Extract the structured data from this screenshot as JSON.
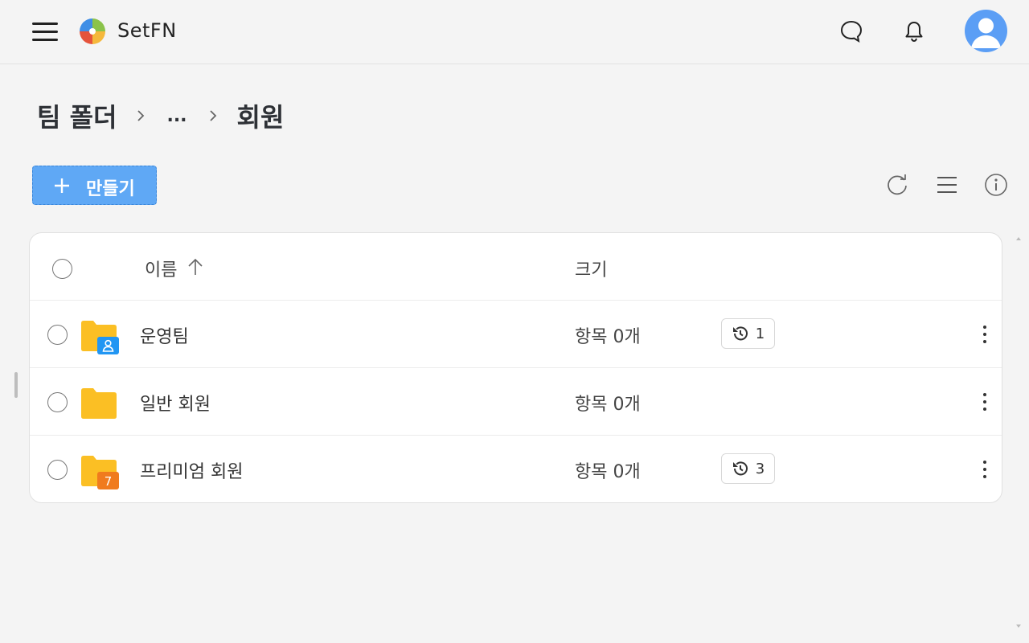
{
  "header": {
    "brand": "SetFN",
    "icons": [
      "menu-icon",
      "chat-icon",
      "bell-icon",
      "avatar-icon"
    ]
  },
  "breadcrumb": {
    "root": "팀 폴더",
    "ellipsis": "...",
    "current": "회원"
  },
  "toolbar": {
    "create_label": "만들기",
    "icons": [
      "refresh-icon",
      "list-view-icon",
      "info-icon"
    ]
  },
  "table": {
    "columns": {
      "name": "이름",
      "size": "크기"
    },
    "sort": "ascending",
    "rows": [
      {
        "name": "운영팀",
        "size": "항목 0개",
        "versions": "1",
        "folder_badge": "user",
        "badge_color": "#2196f3"
      },
      {
        "name": "일반 회원",
        "size": "항목 0개",
        "versions": "",
        "folder_badge": "",
        "badge_color": ""
      },
      {
        "name": "프리미엄 회원",
        "size": "항목 0개",
        "versions": "3",
        "folder_badge": "7",
        "badge_color": "#f07b1e"
      }
    ]
  },
  "colors": {
    "accent": "#5fa8f5",
    "folder": "#fbbf24",
    "background": "#f4f4f4"
  }
}
